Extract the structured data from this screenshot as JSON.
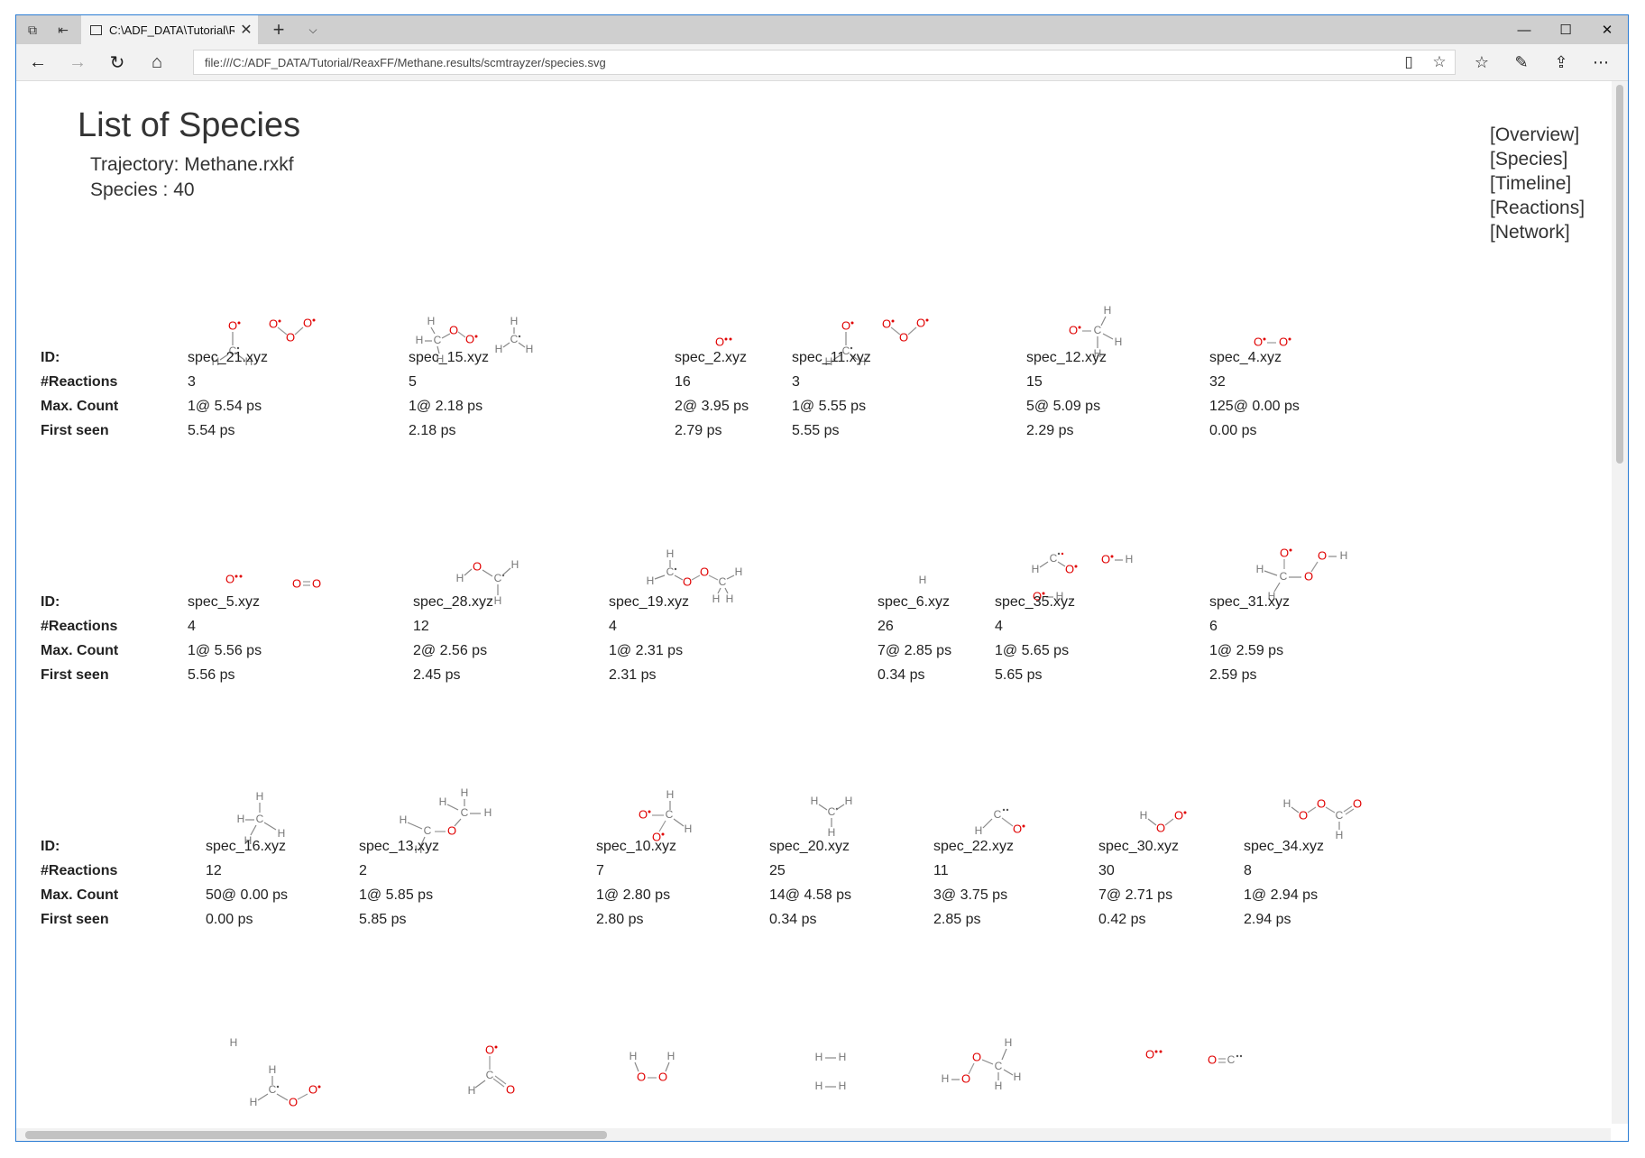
{
  "browser": {
    "tab_title": "C:\\ADF_DATA\\Tutorial\\R",
    "url": "file:///C:/ADF_DATA/Tutorial/ReaxFF/Methane.results/scmtrayzer/species.svg"
  },
  "page": {
    "title": "List of Species",
    "trajectory": "Trajectory: Methane.rxkf",
    "species_count": "Species : 40",
    "links": [
      "[Overview]",
      "[Species]",
      "[Timeline]",
      "[Reactions]",
      "[Network]"
    ]
  },
  "row_labels": {
    "id": "ID:",
    "reactions": "#Reactions",
    "max_count": "Max. Count",
    "first_seen": "First seen"
  },
  "groups": [
    {
      "species": [
        {
          "id": "spec_21.xyz",
          "reactions": "3",
          "max_count": "1@ 5.54 ps",
          "first_seen": "5.54 ps"
        },
        {
          "id": "spec_15.xyz",
          "reactions": "5",
          "max_count": "1@ 2.18 ps",
          "first_seen": "2.18 ps"
        },
        {
          "id": "spec_2.xyz",
          "reactions": "16",
          "max_count": "2@ 3.95 ps",
          "first_seen": "2.79 ps"
        },
        {
          "id": "spec_11.xyz",
          "reactions": "3",
          "max_count": "1@ 5.55 ps",
          "first_seen": "5.55 ps"
        },
        {
          "id": "spec_12.xyz",
          "reactions": "15",
          "max_count": "5@ 5.09 ps",
          "first_seen": "2.29 ps"
        },
        {
          "id": "spec_4.xyz",
          "reactions": "32",
          "max_count": "125@ 0.00 ps",
          "first_seen": "0.00 ps"
        }
      ]
    },
    {
      "species": [
        {
          "id": "spec_5.xyz",
          "reactions": "4",
          "max_count": "1@ 5.56 ps",
          "first_seen": "5.56 ps"
        },
        {
          "id": "spec_28.xyz",
          "reactions": "12",
          "max_count": "2@ 2.56 ps",
          "first_seen": "2.45 ps"
        },
        {
          "id": "spec_19.xyz",
          "reactions": "4",
          "max_count": "1@ 2.31 ps",
          "first_seen": "2.31 ps"
        },
        {
          "id": "spec_6.xyz",
          "reactions": "26",
          "max_count": "7@ 2.85 ps",
          "first_seen": "0.34 ps"
        },
        {
          "id": "spec_35.xyz",
          "reactions": "4",
          "max_count": "1@ 5.65 ps",
          "first_seen": "5.65 ps"
        },
        {
          "id": "spec_31.xyz",
          "reactions": "6",
          "max_count": "1@ 2.59 ps",
          "first_seen": "2.59 ps"
        }
      ]
    },
    {
      "species": [
        {
          "id": "spec_16.xyz",
          "reactions": "12",
          "max_count": "50@ 0.00 ps",
          "first_seen": "0.00 ps"
        },
        {
          "id": "spec_13.xyz",
          "reactions": "2",
          "max_count": "1@ 5.85 ps",
          "first_seen": "5.85 ps"
        },
        {
          "id": "spec_10.xyz",
          "reactions": "7",
          "max_count": "1@ 2.80 ps",
          "first_seen": "2.80 ps"
        },
        {
          "id": "spec_20.xyz",
          "reactions": "25",
          "max_count": "14@ 4.58 ps",
          "first_seen": "0.34 ps"
        },
        {
          "id": "spec_22.xyz",
          "reactions": "11",
          "max_count": "3@ 3.75 ps",
          "first_seen": "2.85 ps"
        },
        {
          "id": "spec_30.xyz",
          "reactions": "30",
          "max_count": "7@ 2.71 ps",
          "first_seen": "0.42 ps"
        },
        {
          "id": "spec_34.xyz",
          "reactions": "8",
          "max_count": "1@ 2.94 ps",
          "first_seen": "2.94 ps"
        }
      ]
    }
  ],
  "atom_labels": {
    "H": "H",
    "C": "C",
    "O": "O"
  }
}
